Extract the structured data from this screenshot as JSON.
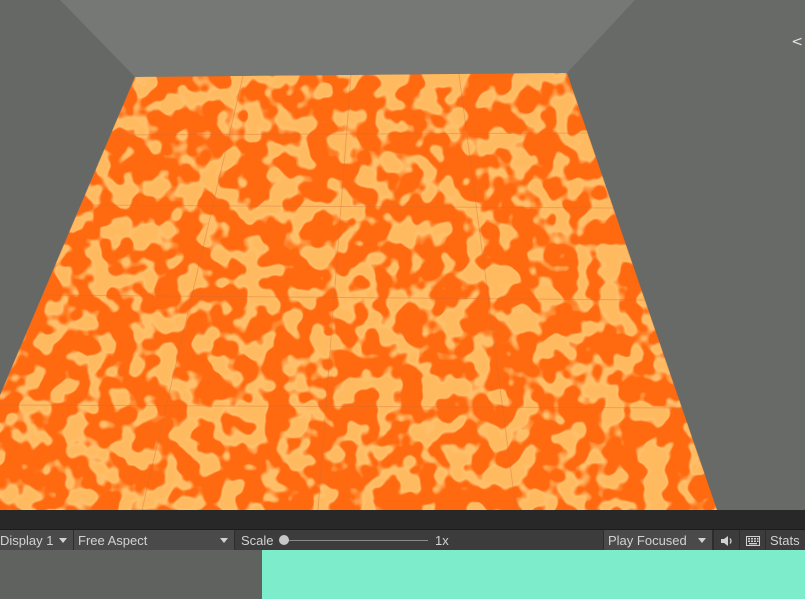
{
  "viewport": {
    "floor_color": "#ff6a10",
    "floor_pattern_color": "#ff8a2a",
    "wall_color": "#6d706d",
    "gizmo_text": "<"
  },
  "toolbar": {
    "display": "Display 1",
    "aspect": "Free Aspect",
    "scale_label": "Scale",
    "scale_value": "1x",
    "play_mode": "Play Focused",
    "mute_icon": "speaker-icon",
    "stats_icon": "keyboard-icon",
    "stats_label": "Stats"
  },
  "colors": {
    "toolbar_bg": "#3c3c3c",
    "panel_accent": "#7ceccb"
  }
}
